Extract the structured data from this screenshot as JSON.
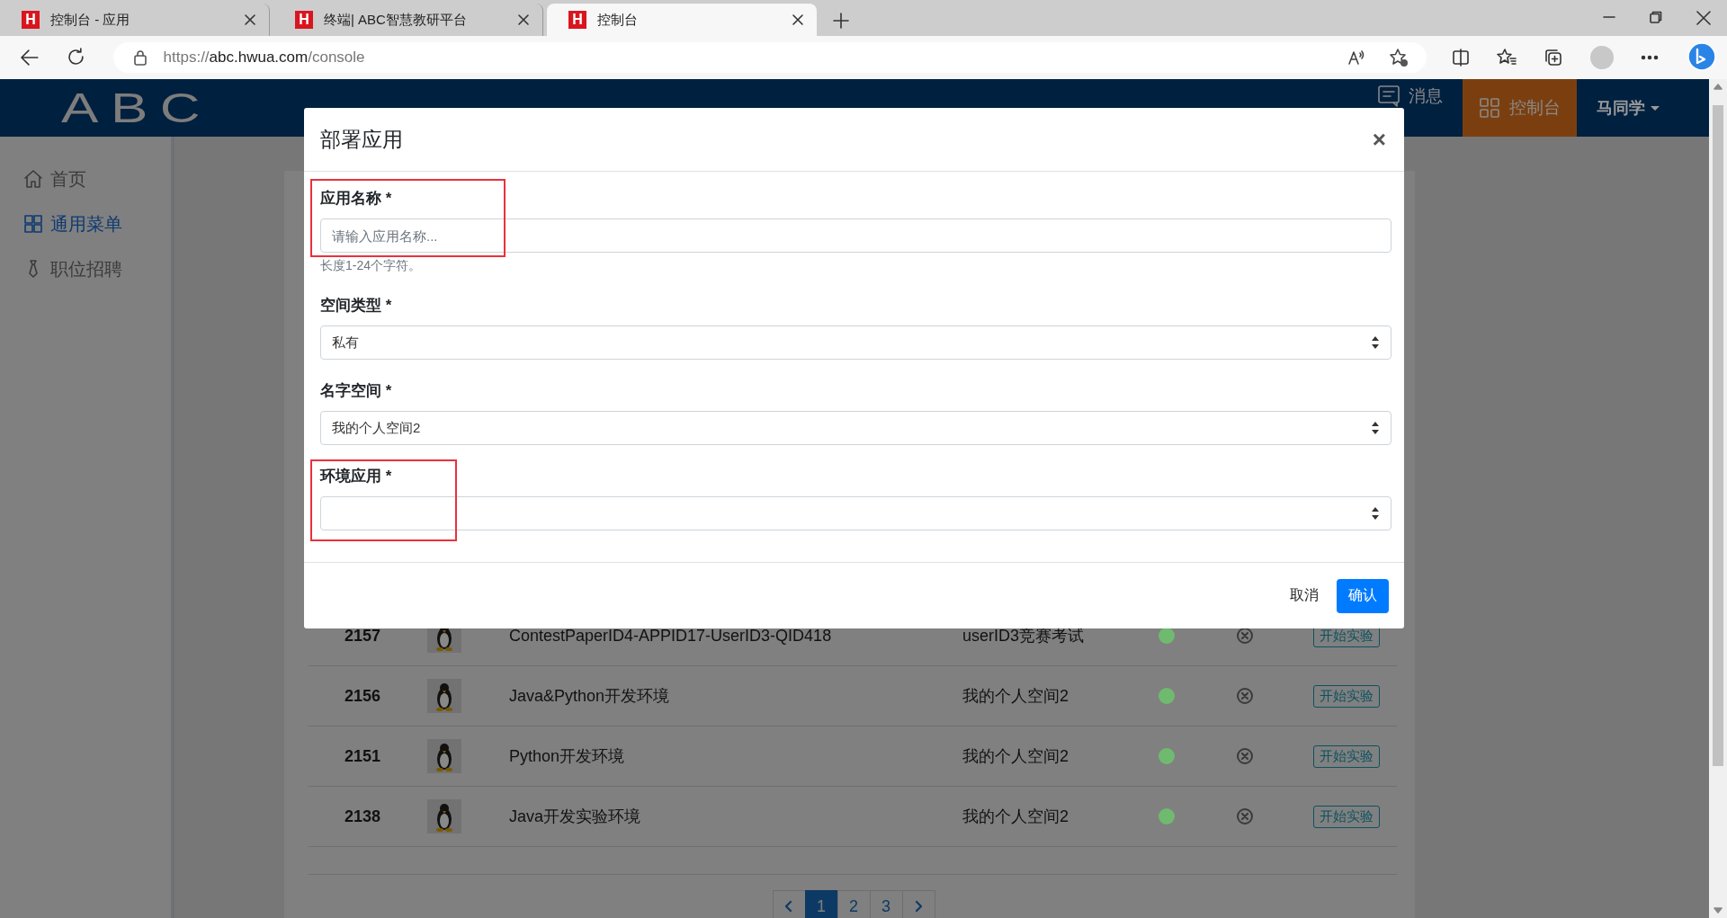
{
  "browser": {
    "tabs": [
      {
        "icon_letter": "H",
        "title": "控制台 - 应用",
        "selected": false
      },
      {
        "icon_letter": "H",
        "title": "终端| ABC智慧教研平台",
        "selected": false
      },
      {
        "icon_letter": "H",
        "title": "控制台",
        "selected": true
      }
    ],
    "url": {
      "scheme": "https://",
      "host": "abc.hwua.com",
      "path": "/console"
    }
  },
  "header": {
    "logo": "ABC",
    "messages": "消息",
    "console": "控制台",
    "user": "马同学"
  },
  "sidebar": {
    "items": [
      {
        "label": "首页",
        "selected": false
      },
      {
        "label": "通用菜单",
        "selected": true
      },
      {
        "label": "职位招聘",
        "selected": false
      }
    ]
  },
  "table": {
    "rows": [
      {
        "id": "2157",
        "name": "ContestPaperID4-APPID17-UserID3-QID418",
        "space": "userID3竞赛考试",
        "color": "#6fba6f",
        "action": "开始实验"
      },
      {
        "id": "2156",
        "name": "Java&Python开发环境",
        "space": "我的个人空间2",
        "color": "#6fba6f",
        "action": "开始实验"
      },
      {
        "id": "2151",
        "name": "Python开发环境",
        "space": "我的个人空间2",
        "color": "#6fba6f",
        "action": "开始实验"
      },
      {
        "id": "2138",
        "name": "Java开发实验环境",
        "space": "我的个人空间2",
        "color": "#6fba6f",
        "action": "开始实验"
      }
    ]
  },
  "pagination": {
    "pages": [
      {
        "label": "1",
        "selected": true
      },
      {
        "label": "2",
        "selected": false
      },
      {
        "label": "3",
        "selected": false
      }
    ]
  },
  "modal": {
    "title": "部署应用",
    "close": "×",
    "fields": [
      {
        "kind": "text",
        "label": "应用名称 *",
        "placeholder": "请输入应用名称...",
        "help": "长度1-24个字符。",
        "highlighted": true
      },
      {
        "kind": "select",
        "label": "空间类型 *",
        "value": "私有",
        "highlighted": false
      },
      {
        "kind": "select",
        "label": "名字空间 *",
        "value": "我的个人空间2",
        "highlighted": false
      },
      {
        "kind": "select",
        "label": "环境应用 *",
        "highlighted": true
      }
    ],
    "buttons": [
      {
        "kind": "link",
        "label": "取消"
      },
      {
        "kind": "primary",
        "label": "确认"
      }
    ]
  }
}
